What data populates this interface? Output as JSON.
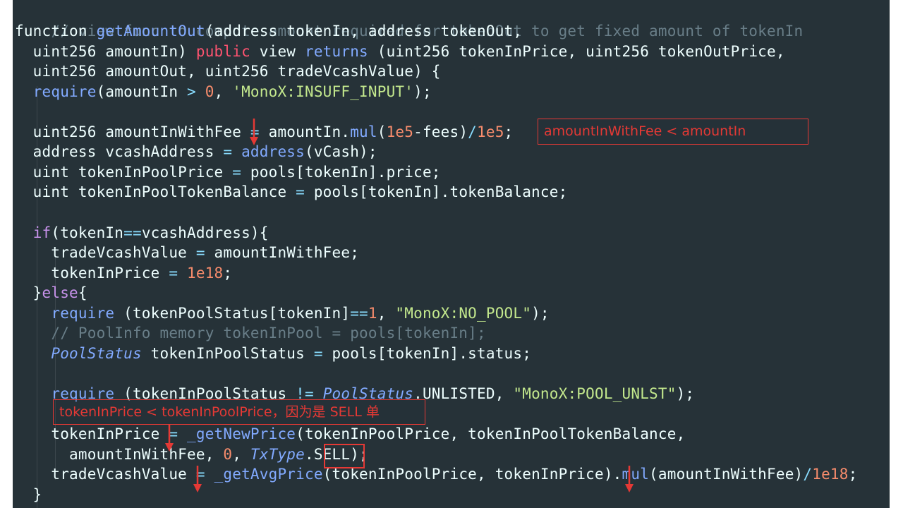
{
  "code": {
    "l1": "// view func to compute amount required for tokenOut to get fixed amount of tokenIn",
    "l2_kw": "function",
    "l2_fn": "getAmountOut",
    "l2_rest": "(address tokenIn, address tokenOut,",
    "l3_a": "  uint256 amountIn) ",
    "l3_public": "public",
    "l3_b": " view ",
    "l3_returns": "returns",
    "l3_c": " (uint256 tokenInPrice, uint256 tokenOutPrice,",
    "l4": "  uint256 amountOut, uint256 tradeVcashValue) {",
    "l5_req": "require",
    "l5_a": "(amountIn ",
    "l5_gt": ">",
    "l5_zero": "0",
    "l5_b": ", ",
    "l5_str": "'MonoX:INSUFF_INPUT'",
    "l5_c": ");",
    "l7_a": "  uint256 amountInWithFee ",
    "l7_eq": "=",
    "l7_b": " amountIn.",
    "l7_mul": "mul",
    "l7_c": "(",
    "l7_1e5": "1e5",
    "l7_d": "-fees)",
    "l7_div": "/",
    "l7_1e5b": "1e5",
    "l7_e": ";",
    "l8_a": "  address vcashAddress ",
    "l8_eq": "=",
    "l8_addr": "address",
    "l8_b": "(vCash);",
    "l9_a": "  uint tokenInPoolPrice ",
    "l9_eq": "=",
    "l9_b": " pools[tokenIn].price;",
    "l10_a": "  uint tokenInPoolTokenBalance ",
    "l10_eq": "=",
    "l10_b": " pools[tokenIn].tokenBalance;",
    "l12_if": "if",
    "l12_a": "(tokenIn",
    "l12_eqeq": "==",
    "l12_b": "vcashAddress){",
    "l13_a": "    tradeVcashValue ",
    "l13_eq": "=",
    "l13_b": " amountInWithFee;",
    "l14_a": "    tokenInPrice ",
    "l14_eq": "=",
    "l14_n": "1e18",
    "l14_b": ";",
    "l15_a": "  }",
    "l15_else": "else",
    "l15_b": "{",
    "l16_req": "require",
    "l16_a": " (tokenPoolStatus[tokenIn]",
    "l16_eqeq": "==",
    "l16_one": "1",
    "l16_b": ", ",
    "l16_str": "\"MonoX:NO_POOL\"",
    "l16_c": ");",
    "l17": "    // PoolInfo memory tokenInPool = pools[tokenIn];",
    "l18_type": "PoolStatus",
    "l18_a": " tokenInPoolStatus ",
    "l18_eq": "=",
    "l18_b": " pools[tokenIn].status;",
    "l20_req": "require",
    "l20_a": " (tokenInPoolStatus ",
    "l20_ne": "!=",
    "l20_type": "PoolStatus",
    "l20_b": ".UNLISTED, ",
    "l20_str": "\"MonoX:POOL_UNLST\"",
    "l20_c": ");",
    "l22_a": "    tokenInPrice ",
    "l22_eq": "=",
    "l22_fn": "_getNewPrice",
    "l22_b": "(tokenInPoolPrice, tokenInPoolTokenBalance,",
    "l23_a": "      amountInWithFee, ",
    "l23_zero": "0",
    "l23_b": ", ",
    "l23_type": "TxType",
    "l23_c": ".",
    "l23_sell": "SELL",
    "l23_d": ");",
    "l24_a": "    tradeVcashValue ",
    "l24_eq": "=",
    "l24_fn": "_getAvgPrice",
    "l24_b": "(tokenInPoolPrice, tokenInPrice).",
    "l24_mul": "mul",
    "l24_c": "(amountInWithFee)",
    "l24_div": "/",
    "l24_n": "1e18",
    "l24_d": ";",
    "l25": "  }"
  },
  "annotations": {
    "fee_note": "amountInWithFee < amountIn",
    "price_note": "tokenInPrice < tokenInPoolPrice，因为是 SELL 单"
  },
  "colors": {
    "background": "#263238",
    "comment": "#697e88",
    "function": "#82aaff",
    "keyword": "#c792ea",
    "operator": "#89ddff",
    "number": "#f78c6c",
    "string": "#c3e88d",
    "annotation": "#e53935"
  }
}
